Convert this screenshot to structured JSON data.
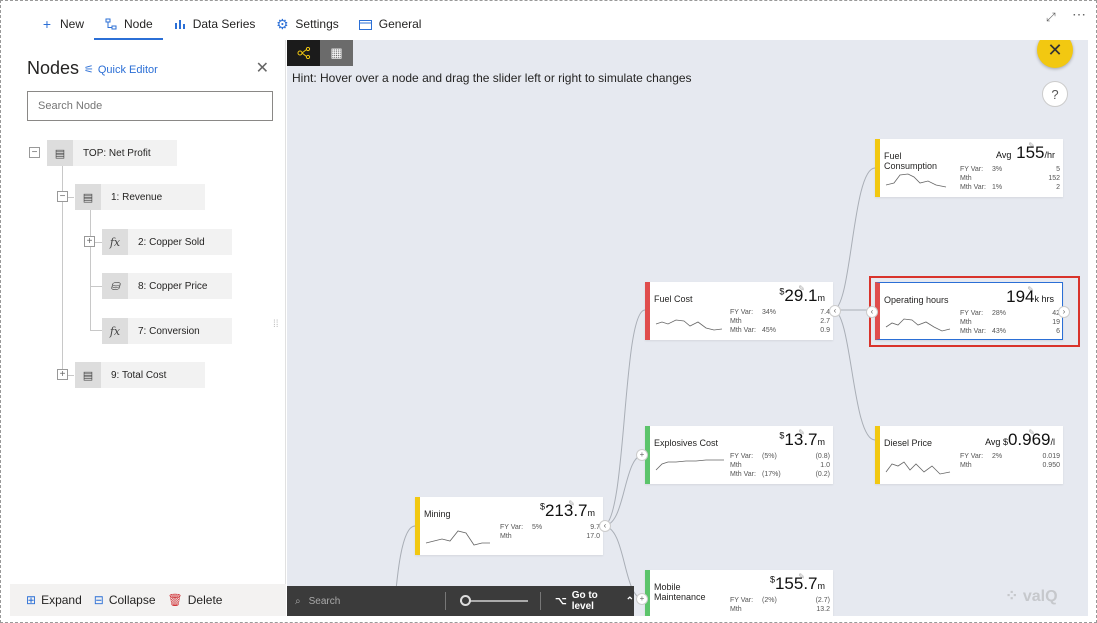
{
  "menu": {
    "items": [
      {
        "label": "New",
        "icon": "plus-icon",
        "active": false
      },
      {
        "label": "Node",
        "icon": "node-tree-icon",
        "active": true
      },
      {
        "label": "Data Series",
        "icon": "bar-chart-icon",
        "active": false
      },
      {
        "label": "Settings",
        "icon": "gear-icon",
        "active": false
      },
      {
        "label": "General",
        "icon": "general-icon",
        "active": false
      }
    ]
  },
  "nodes_panel": {
    "title": "Nodes",
    "quick_editor": "Quick Editor",
    "search_placeholder": "Search Node",
    "tree": [
      {
        "label": "TOP: Net Profit",
        "icon": "calc-icon",
        "toggle": "−"
      },
      {
        "label": "1: Revenue",
        "icon": "calc-icon",
        "toggle": "−"
      },
      {
        "label": "2: Copper Sold",
        "icon": "function-icon",
        "toggle": "+"
      },
      {
        "label": "8: Copper Price",
        "icon": "database-icon",
        "toggle": ""
      },
      {
        "label": "7: Conversion",
        "icon": "function-icon",
        "toggle": ""
      },
      {
        "label": "9: Total Cost",
        "icon": "calc-icon",
        "toggle": "+"
      }
    ],
    "footer": {
      "expand": "Expand",
      "collapse": "Collapse",
      "delete": "Delete"
    }
  },
  "canvas": {
    "hint": "Hint: Hover over a node and drag the slider left or right to simulate changes",
    "help": "?",
    "close": "✕",
    "bottom_bar": {
      "search": "Search",
      "go_to_level": "Go to level"
    },
    "logo": "valQ"
  },
  "cards": {
    "fuel_consumption": {
      "name": "Fuel Consumption",
      "prefix": "Avg",
      "value": "155",
      "unit": "/hr",
      "rows": [
        [
          "FY Var:",
          "3%",
          "5"
        ],
        [
          "Mth",
          "",
          "152"
        ],
        [
          "Mth Var:",
          "1%",
          "2"
        ]
      ]
    },
    "fuel_cost": {
      "name": "Fuel Cost",
      "prefix": "$",
      "value": "29.1",
      "unit": "m",
      "rows": [
        [
          "FY Var:",
          "34%",
          "7.4"
        ],
        [
          "Mth",
          "",
          "2.7"
        ],
        [
          "Mth Var:",
          "45%",
          "0.9"
        ]
      ]
    },
    "operating_hours": {
      "name": "Operating hours",
      "prefix": "",
      "value": "194",
      "unit": "k hrs",
      "rows": [
        [
          "FY Var:",
          "28%",
          "42"
        ],
        [
          "Mth",
          "",
          "19"
        ],
        [
          "Mth Var:",
          "43%",
          "6"
        ]
      ]
    },
    "explosives_cost": {
      "name": "Explosives Cost",
      "prefix": "$",
      "value": "13.7",
      "unit": "m",
      "rows": [
        [
          "FY Var:",
          "(5%)",
          "(0.8)"
        ],
        [
          "Mth",
          "",
          "1.0"
        ],
        [
          "Mth Var:",
          "(17%)",
          "(0.2)"
        ]
      ]
    },
    "diesel_price": {
      "name": "Diesel Price",
      "prefix": "Avg $",
      "value": "0.969",
      "unit": "/l",
      "rows": [
        [
          "FY Var:",
          "2%",
          "0.019"
        ],
        [
          "Mth",
          "",
          "0.950"
        ]
      ]
    },
    "mining": {
      "name": "Mining",
      "prefix": "$",
      "value": "213.7",
      "unit": "m",
      "rows": [
        [
          "FY Var:",
          "5%",
          "9.7"
        ],
        [
          "Mth",
          "",
          "17.0"
        ]
      ]
    },
    "mobile_maintenance": {
      "name": "Mobile Maintenance",
      "prefix": "$",
      "value": "155.7",
      "unit": "m",
      "rows": [
        [
          "FY Var:",
          "(2%)",
          "(2.7)"
        ],
        [
          "Mth",
          "",
          "13.2"
        ]
      ]
    }
  }
}
